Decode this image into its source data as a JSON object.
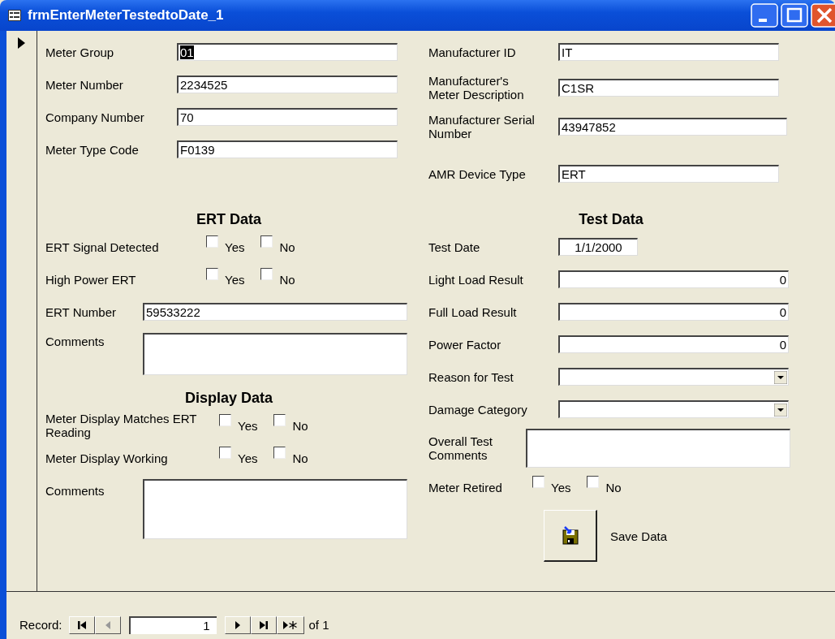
{
  "window": {
    "title": "frmEnterMeterTestedtoDate_1"
  },
  "left": {
    "sections": [
      {
        "rows": [
          {
            "kind": "text",
            "label": "Meter Group",
            "value": "01",
            "selected": true
          },
          {
            "kind": "text",
            "label": "Meter Number",
            "value": "2234525",
            "selected": false
          },
          {
            "kind": "text",
            "label": "Company Number",
            "value": "70",
            "selected": false
          },
          {
            "kind": "text",
            "label": "Meter Type Code",
            "value": "F0139",
            "selected": false
          }
        ]
      },
      {
        "heading": "ERT Data",
        "rows": [
          {
            "kind": "checks",
            "label": "ERT Signal Detected",
            "yes": {
              "label": "Yes",
              "checked": false
            },
            "no": {
              "label": "No",
              "checked": false
            }
          },
          {
            "kind": "checks",
            "label": "High Power ERT",
            "yes": {
              "label": "Yes",
              "checked": false
            },
            "no": {
              "label": "No",
              "checked": false
            }
          },
          {
            "kind": "text",
            "label": "ERT Number",
            "value": "59533222",
            "selected": false
          },
          {
            "kind": "memo",
            "label": "Comments"
          }
        ]
      },
      {
        "heading": "Display Data",
        "rows": [
          {
            "kind": "checks",
            "label": "Meter Display Matches ERT Reading",
            "yes": {
              "label": "Yes",
              "checked": false
            },
            "no": {
              "label": "No",
              "checked": false
            }
          },
          {
            "kind": "checks",
            "label": "Meter Display Working",
            "yes": {
              "label": "Yes",
              "checked": false
            },
            "no": {
              "label": "No",
              "checked": false
            }
          },
          {
            "kind": "memo",
            "label": "Comments"
          }
        ]
      }
    ]
  },
  "right": {
    "sections": [
      {
        "rows": [
          {
            "kind": "text",
            "label": "Manufacturer ID",
            "value": "IT",
            "selected": false
          },
          {
            "kind": "text",
            "label": "Manufacturer's Meter Description",
            "value": "C1SR",
            "selected": false
          },
          {
            "kind": "text",
            "label": "Manufacturer Serial Number",
            "value": "43947852",
            "selected": false
          },
          {
            "kind": "text",
            "label": "AMR Device Type",
            "value": "ERT",
            "selected": false
          }
        ]
      },
      {
        "heading": "Test Data",
        "rows": [
          {
            "kind": "date",
            "label": "Test Date",
            "value": "1/1/2000",
            "selected": false
          },
          {
            "kind": "number",
            "label": "Light Load Result",
            "value": "0",
            "selected": false
          },
          {
            "kind": "number",
            "label": "Full Load Result",
            "value": "0",
            "selected": false
          },
          {
            "kind": "number",
            "label": "Power Factor",
            "value": "0",
            "selected": false
          },
          {
            "kind": "combo",
            "label": "Reason for Test"
          },
          {
            "kind": "combo",
            "label": "Damage Category"
          },
          {
            "kind": "memo",
            "label": "Overall Test Comments"
          },
          {
            "kind": "checks",
            "label": "Meter Retired",
            "yes": {
              "label": "Yes",
              "checked": false
            },
            "no": {
              "label": "No",
              "checked": false
            }
          }
        ]
      }
    ]
  },
  "save_button": {
    "label": "Save Data"
  },
  "navigation": {
    "label": "Record:",
    "current": "1",
    "total": "of 1",
    "buttons": [
      {
        "kind": "first",
        "disabled": false
      },
      {
        "kind": "prev",
        "disabled": true
      },
      {
        "kind": "next",
        "disabled": false
      },
      {
        "kind": "last",
        "disabled": false
      },
      {
        "kind": "new",
        "disabled": false
      }
    ]
  }
}
